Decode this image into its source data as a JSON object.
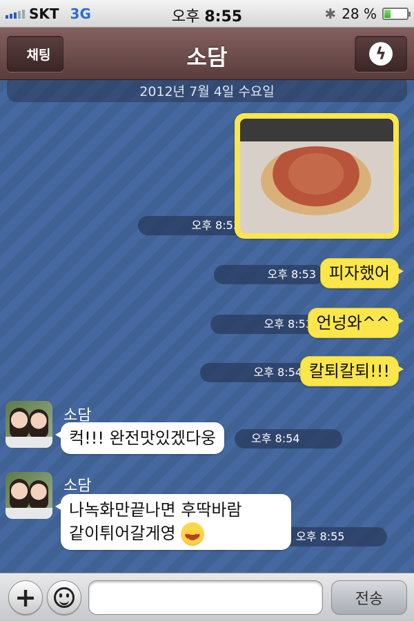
{
  "status_bar": {
    "carrier": "SKT",
    "network": "3G",
    "time_prefix": "오후",
    "time": "8:55",
    "battery_text": "28 %",
    "battery_level": 0.28,
    "signal_bars": 3
  },
  "navbar": {
    "back_label": "채팅",
    "title": "소담",
    "menu_icon": "lightning-icon"
  },
  "chat": {
    "date_separator": "2012년 7월 4일 수요일",
    "messages": [
      {
        "from": "me",
        "type": "photo",
        "time": "오후 8:53"
      },
      {
        "from": "me",
        "text": "피자했어",
        "time": "오후 8:53"
      },
      {
        "from": "me",
        "text": "언넝와^^",
        "time": "오후 8:53"
      },
      {
        "from": "me",
        "text": "칼퇴칼퇴!!!",
        "time": "오후 8:54"
      },
      {
        "from": "소담",
        "sender": "소담",
        "text": "컥!!! 완전맛있겠다웅",
        "time": "오후 8:54"
      },
      {
        "from": "소담",
        "sender": "소담",
        "line1": "나녹화만끝나면 후딱바람",
        "line2": "같이튀어갈게영",
        "time": "오후 8:55"
      }
    ]
  },
  "input_bar": {
    "input_value": "",
    "send_label": "전송"
  },
  "colors": {
    "my_bubble": "#fbe64b",
    "their_bubble": "#ffffff",
    "navbar": "#6b4b4b",
    "background": "#3e5f8e"
  }
}
